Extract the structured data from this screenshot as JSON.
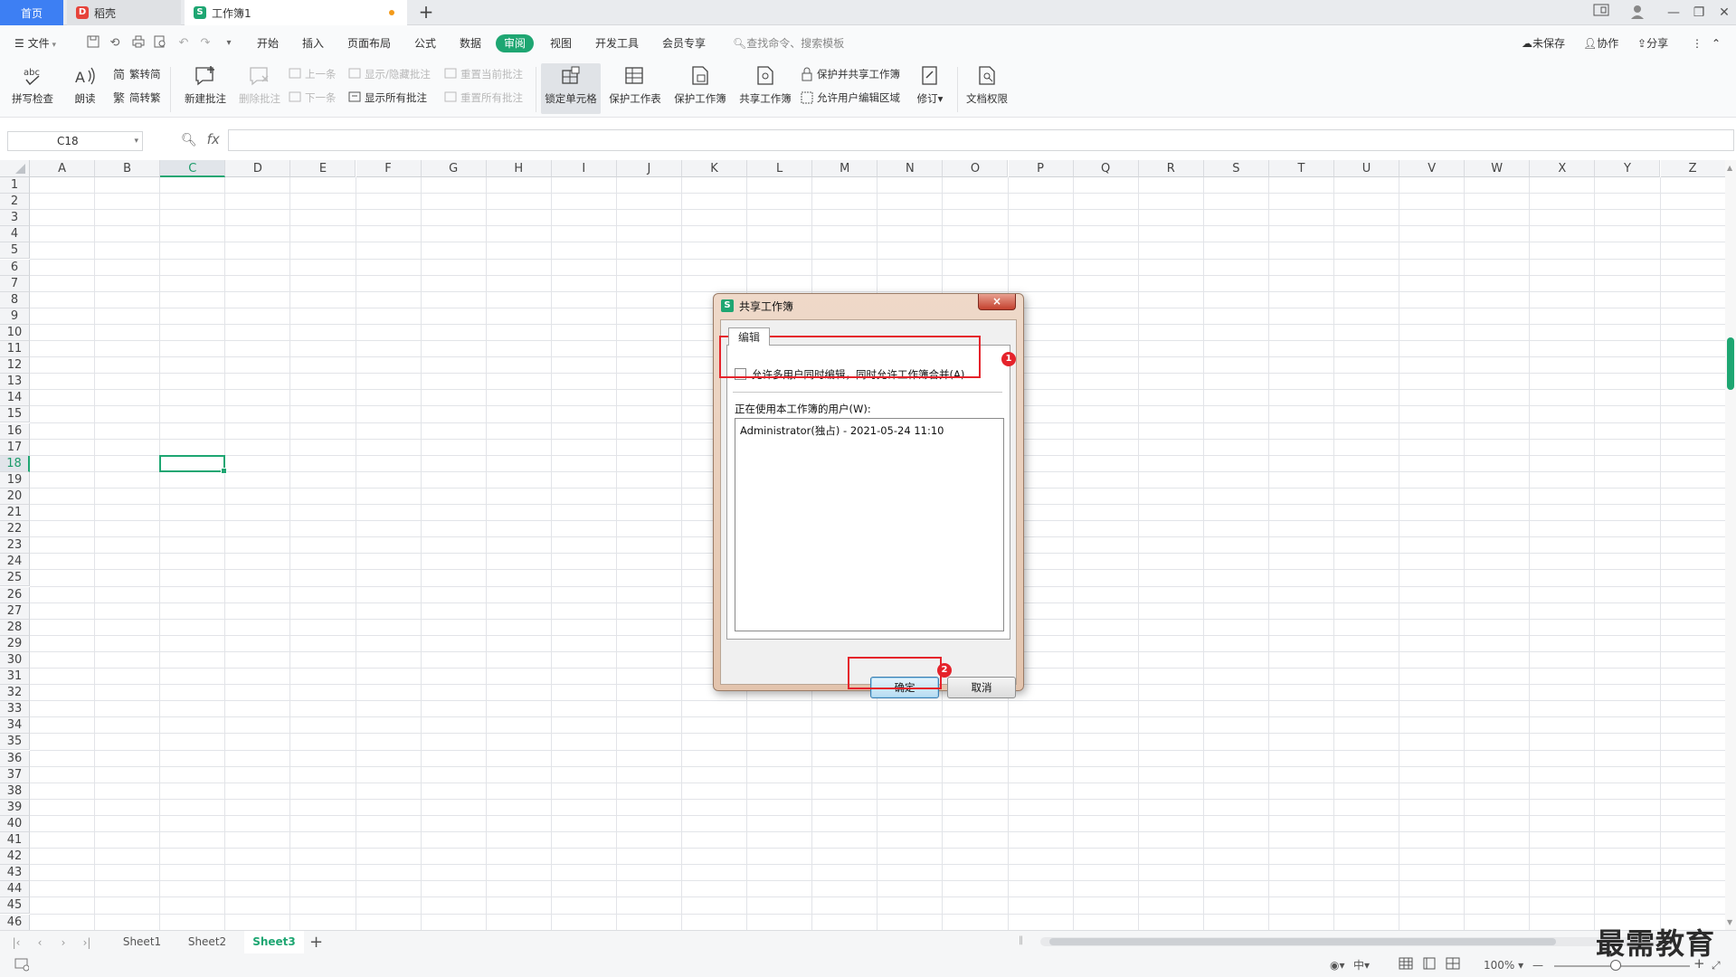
{
  "tabs": {
    "home": "首页",
    "docer": "稻壳",
    "workbook": "工作簿1",
    "add": "+"
  },
  "menu": {
    "file": "文件",
    "items": [
      "开始",
      "插入",
      "页面布局",
      "公式",
      "数据",
      "审阅",
      "视图",
      "开发工具",
      "会员专享"
    ],
    "active_index": 5,
    "search_placeholder": "查找命令、搜索模板",
    "unsaved": "未保存",
    "collab": "协作",
    "share": "分享"
  },
  "ribbon": {
    "spell_check": "拼写检查",
    "read_aloud": "朗读",
    "trad_simp": "繁转简",
    "simp_trad": "简转繁",
    "new_comment": "新建批注",
    "delete_comment": "删除批注",
    "prev": "上一条",
    "next": "下一条",
    "show_hide_comment": "显示/隐藏批注",
    "show_all_comments": "显示所有批注",
    "reset_current_comment": "重置当前批注",
    "reset_all_comments": "重置所有批注",
    "lock_cell": "锁定单元格",
    "protect_sheet": "保护工作表",
    "protect_workbook": "保护工作簿",
    "share_workbook": "共享工作簿",
    "protect_share_workbook": "保护并共享工作簿",
    "allow_edit_ranges": "允许用户编辑区域",
    "track_changes": "修订",
    "doc_permission": "文档权限"
  },
  "formula_bar": {
    "cell_ref": "C18",
    "fx": "fx",
    "value": ""
  },
  "grid": {
    "columns": [
      "A",
      "B",
      "C",
      "D",
      "E",
      "F",
      "G",
      "H",
      "I",
      "J",
      "K",
      "L",
      "M",
      "N",
      "O",
      "P",
      "Q",
      "R",
      "S",
      "T",
      "U",
      "V",
      "W",
      "X",
      "Y",
      "Z"
    ],
    "rows": [
      "1",
      "2",
      "3",
      "4",
      "5",
      "6",
      "7",
      "8",
      "9",
      "10",
      "11",
      "12",
      "13",
      "14",
      "15",
      "16",
      "17",
      "18",
      "19",
      "20",
      "21",
      "22",
      "23",
      "24",
      "25",
      "26",
      "27",
      "28",
      "29",
      "30",
      "31",
      "32",
      "33",
      "34",
      "35",
      "36",
      "37",
      "38",
      "39",
      "40",
      "41",
      "42",
      "43",
      "44",
      "45",
      "46"
    ],
    "selected_col": "C",
    "selected_row": "18"
  },
  "sheets": {
    "items": [
      "Sheet1",
      "Sheet2",
      "Sheet3"
    ],
    "active": "Sheet3"
  },
  "status": {
    "zoom": "100%"
  },
  "watermark": "最需教育",
  "dialog": {
    "title": "共享工作簿",
    "tab": "编辑",
    "checkbox_label": "允许多用户同时编辑，同时允许工作簿合并(A)",
    "checkbox_checked": false,
    "users_label": "正在使用本工作簿的用户(W):",
    "users": [
      "Administrator(独占) - 2021-05-24 11:10"
    ],
    "ok": "确定",
    "cancel": "取消",
    "close": "×"
  },
  "annotations": [
    "1",
    "2"
  ],
  "colors": {
    "accent": "#1ea672",
    "tab_home": "#3d7ff3",
    "annotation": "#e5232b"
  }
}
